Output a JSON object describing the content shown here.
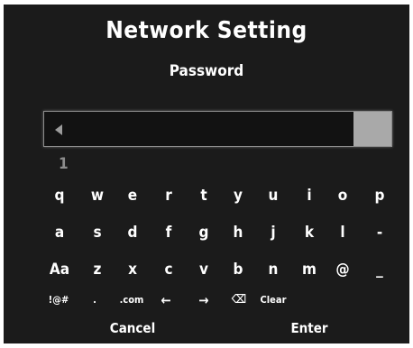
{
  "header": {
    "title": "Network Setting",
    "subtitle": "Password"
  },
  "password_field": {
    "value": "",
    "cursor_icon": "left-arrow-icon"
  },
  "prediction": "1",
  "keyboard": {
    "rows": [
      [
        "q",
        "w",
        "e",
        "r",
        "t",
        "y",
        "u",
        "i",
        "o",
        "p"
      ],
      [
        "a",
        "s",
        "d",
        "f",
        "g",
        "h",
        "j",
        "k",
        "l",
        "-"
      ],
      [
        "Aa",
        "z",
        "x",
        "c",
        "v",
        "b",
        "n",
        "m",
        "@",
        "_"
      ],
      [
        "!@#",
        ".",
        ".com",
        "←",
        "→",
        "⌫",
        "Clear"
      ]
    ],
    "backspace_icon": "backspace-icon"
  },
  "actions": {
    "cancel": "Cancel",
    "enter": "Enter"
  },
  "colors": {
    "background": "#1b1b1b",
    "text": "#ffffff",
    "field_button": "#a9a9a9",
    "prediction": "#8d8d8d"
  }
}
